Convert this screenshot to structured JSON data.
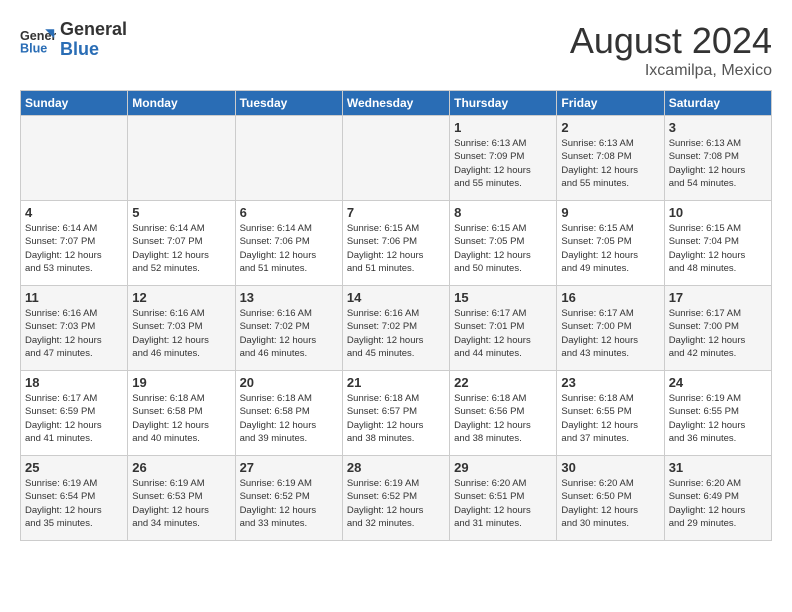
{
  "header": {
    "logo_general": "General",
    "logo_blue": "Blue",
    "month_title": "August 2024",
    "location": "Ixcamilpa, Mexico"
  },
  "days_of_week": [
    "Sunday",
    "Monday",
    "Tuesday",
    "Wednesday",
    "Thursday",
    "Friday",
    "Saturday"
  ],
  "weeks": [
    [
      {
        "day": "",
        "info": ""
      },
      {
        "day": "",
        "info": ""
      },
      {
        "day": "",
        "info": ""
      },
      {
        "day": "",
        "info": ""
      },
      {
        "day": "1",
        "info": "Sunrise: 6:13 AM\nSunset: 7:09 PM\nDaylight: 12 hours\nand 55 minutes."
      },
      {
        "day": "2",
        "info": "Sunrise: 6:13 AM\nSunset: 7:08 PM\nDaylight: 12 hours\nand 55 minutes."
      },
      {
        "day": "3",
        "info": "Sunrise: 6:13 AM\nSunset: 7:08 PM\nDaylight: 12 hours\nand 54 minutes."
      }
    ],
    [
      {
        "day": "4",
        "info": "Sunrise: 6:14 AM\nSunset: 7:07 PM\nDaylight: 12 hours\nand 53 minutes."
      },
      {
        "day": "5",
        "info": "Sunrise: 6:14 AM\nSunset: 7:07 PM\nDaylight: 12 hours\nand 52 minutes."
      },
      {
        "day": "6",
        "info": "Sunrise: 6:14 AM\nSunset: 7:06 PM\nDaylight: 12 hours\nand 51 minutes."
      },
      {
        "day": "7",
        "info": "Sunrise: 6:15 AM\nSunset: 7:06 PM\nDaylight: 12 hours\nand 51 minutes."
      },
      {
        "day": "8",
        "info": "Sunrise: 6:15 AM\nSunset: 7:05 PM\nDaylight: 12 hours\nand 50 minutes."
      },
      {
        "day": "9",
        "info": "Sunrise: 6:15 AM\nSunset: 7:05 PM\nDaylight: 12 hours\nand 49 minutes."
      },
      {
        "day": "10",
        "info": "Sunrise: 6:15 AM\nSunset: 7:04 PM\nDaylight: 12 hours\nand 48 minutes."
      }
    ],
    [
      {
        "day": "11",
        "info": "Sunrise: 6:16 AM\nSunset: 7:03 PM\nDaylight: 12 hours\nand 47 minutes."
      },
      {
        "day": "12",
        "info": "Sunrise: 6:16 AM\nSunset: 7:03 PM\nDaylight: 12 hours\nand 46 minutes."
      },
      {
        "day": "13",
        "info": "Sunrise: 6:16 AM\nSunset: 7:02 PM\nDaylight: 12 hours\nand 46 minutes."
      },
      {
        "day": "14",
        "info": "Sunrise: 6:16 AM\nSunset: 7:02 PM\nDaylight: 12 hours\nand 45 minutes."
      },
      {
        "day": "15",
        "info": "Sunrise: 6:17 AM\nSunset: 7:01 PM\nDaylight: 12 hours\nand 44 minutes."
      },
      {
        "day": "16",
        "info": "Sunrise: 6:17 AM\nSunset: 7:00 PM\nDaylight: 12 hours\nand 43 minutes."
      },
      {
        "day": "17",
        "info": "Sunrise: 6:17 AM\nSunset: 7:00 PM\nDaylight: 12 hours\nand 42 minutes."
      }
    ],
    [
      {
        "day": "18",
        "info": "Sunrise: 6:17 AM\nSunset: 6:59 PM\nDaylight: 12 hours\nand 41 minutes."
      },
      {
        "day": "19",
        "info": "Sunrise: 6:18 AM\nSunset: 6:58 PM\nDaylight: 12 hours\nand 40 minutes."
      },
      {
        "day": "20",
        "info": "Sunrise: 6:18 AM\nSunset: 6:58 PM\nDaylight: 12 hours\nand 39 minutes."
      },
      {
        "day": "21",
        "info": "Sunrise: 6:18 AM\nSunset: 6:57 PM\nDaylight: 12 hours\nand 38 minutes."
      },
      {
        "day": "22",
        "info": "Sunrise: 6:18 AM\nSunset: 6:56 PM\nDaylight: 12 hours\nand 38 minutes."
      },
      {
        "day": "23",
        "info": "Sunrise: 6:18 AM\nSunset: 6:55 PM\nDaylight: 12 hours\nand 37 minutes."
      },
      {
        "day": "24",
        "info": "Sunrise: 6:19 AM\nSunset: 6:55 PM\nDaylight: 12 hours\nand 36 minutes."
      }
    ],
    [
      {
        "day": "25",
        "info": "Sunrise: 6:19 AM\nSunset: 6:54 PM\nDaylight: 12 hours\nand 35 minutes."
      },
      {
        "day": "26",
        "info": "Sunrise: 6:19 AM\nSunset: 6:53 PM\nDaylight: 12 hours\nand 34 minutes."
      },
      {
        "day": "27",
        "info": "Sunrise: 6:19 AM\nSunset: 6:52 PM\nDaylight: 12 hours\nand 33 minutes."
      },
      {
        "day": "28",
        "info": "Sunrise: 6:19 AM\nSunset: 6:52 PM\nDaylight: 12 hours\nand 32 minutes."
      },
      {
        "day": "29",
        "info": "Sunrise: 6:20 AM\nSunset: 6:51 PM\nDaylight: 12 hours\nand 31 minutes."
      },
      {
        "day": "30",
        "info": "Sunrise: 6:20 AM\nSunset: 6:50 PM\nDaylight: 12 hours\nand 30 minutes."
      },
      {
        "day": "31",
        "info": "Sunrise: 6:20 AM\nSunset: 6:49 PM\nDaylight: 12 hours\nand 29 minutes."
      }
    ]
  ]
}
